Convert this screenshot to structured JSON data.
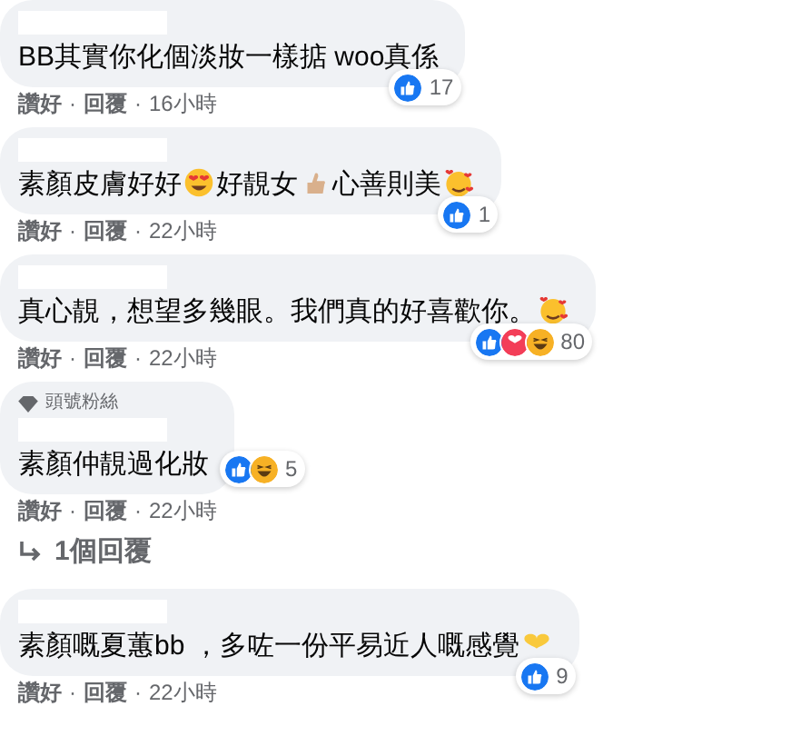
{
  "comments": [
    {
      "segments": [
        {
          "kind": "text",
          "text": "BB其實你化個淡妝一樣掂 woo真係"
        }
      ],
      "reactions": [
        {
          "kind": "like"
        }
      ],
      "reaction_count": "17",
      "actions": [
        {
          "kind": "link",
          "text": "讚好"
        },
        {
          "kind": "sep",
          "text": "·"
        },
        {
          "kind": "link",
          "text": "回覆"
        },
        {
          "kind": "sep",
          "text": "·"
        },
        {
          "kind": "time",
          "text": "16小時"
        }
      ]
    },
    {
      "segments": [
        {
          "kind": "text",
          "text": "素顏皮膚好好"
        },
        {
          "kind": "heart-eyes"
        },
        {
          "kind": "text",
          "text": "好靚女"
        },
        {
          "kind": "thumbs-up"
        },
        {
          "kind": "text",
          "text": "心善則美"
        },
        {
          "kind": "hearts-face"
        }
      ],
      "reactions": [
        {
          "kind": "like"
        }
      ],
      "reaction_count": "1",
      "actions": [
        {
          "kind": "link",
          "text": "讚好"
        },
        {
          "kind": "sep",
          "text": "·"
        },
        {
          "kind": "link",
          "text": "回覆"
        },
        {
          "kind": "sep",
          "text": "·"
        },
        {
          "kind": "time",
          "text": "22小時"
        }
      ]
    },
    {
      "segments": [
        {
          "kind": "text",
          "text": "真心靚，想望多幾眼。我們真的好喜歡你。"
        },
        {
          "kind": "hearts-face"
        }
      ],
      "reactions": [
        {
          "kind": "like"
        },
        {
          "kind": "love"
        },
        {
          "kind": "haha"
        }
      ],
      "reaction_count": "80",
      "actions": [
        {
          "kind": "link",
          "text": "讚好"
        },
        {
          "kind": "sep",
          "text": "·"
        },
        {
          "kind": "link",
          "text": "回覆"
        },
        {
          "kind": "sep",
          "text": "·"
        },
        {
          "kind": "time",
          "text": "22小時"
        }
      ]
    },
    {
      "badge": "頭號粉絲",
      "segments": [
        {
          "kind": "text",
          "text": "素顏仲靚過化妝"
        }
      ],
      "reactions": [
        {
          "kind": "like"
        },
        {
          "kind": "haha"
        }
      ],
      "reaction_count": "5",
      "actions": [
        {
          "kind": "link",
          "text": "讚好"
        },
        {
          "kind": "sep",
          "text": "·"
        },
        {
          "kind": "link",
          "text": "回覆"
        },
        {
          "kind": "sep",
          "text": "·"
        },
        {
          "kind": "time",
          "text": "22小時"
        }
      ],
      "replies": "1個回覆"
    },
    {
      "segments": [
        {
          "kind": "text",
          "text": "素顏嘅夏蕙bb ，多咗一份平易近人嘅感覺"
        },
        {
          "kind": "yellow-heart"
        }
      ],
      "reactions": [
        {
          "kind": "like"
        }
      ],
      "reaction_count": "9",
      "actions": [
        {
          "kind": "link",
          "text": "讚好"
        },
        {
          "kind": "sep",
          "text": "·"
        },
        {
          "kind": "link",
          "text": "回覆"
        },
        {
          "kind": "sep",
          "text": "·"
        },
        {
          "kind": "time",
          "text": "22小時"
        }
      ]
    }
  ]
}
